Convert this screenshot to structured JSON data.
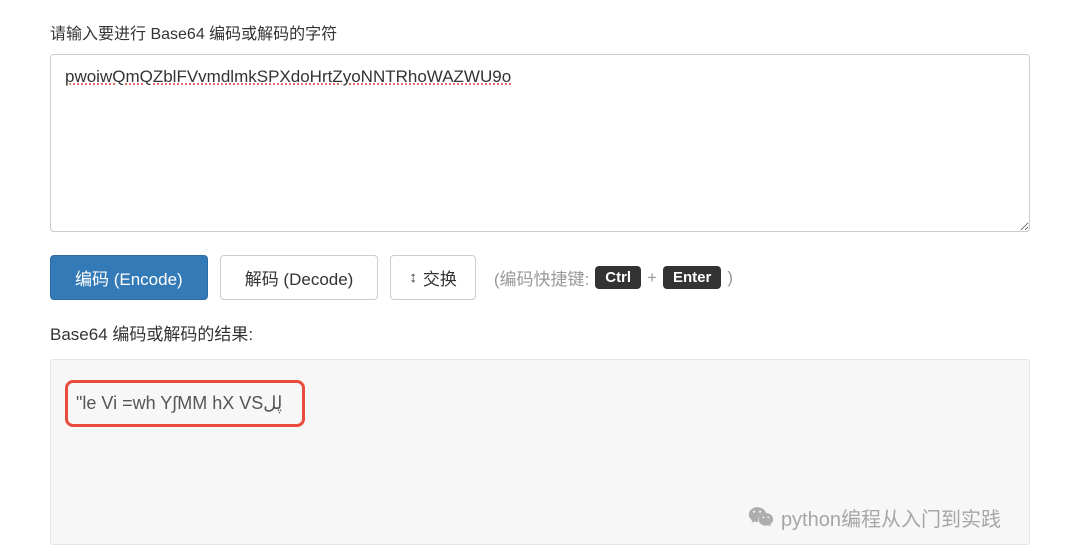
{
  "labels": {
    "input_prompt": "请输入要进行 Base64 编码或解码的字符",
    "result_prompt": "Base64 编码或解码的结果:"
  },
  "input": {
    "value": "pwoiwQmQZblFVvmdlmkSPXdoHrtZyoNNTRhoWAZWU9o"
  },
  "buttons": {
    "encode": "编码 (Encode)",
    "decode": "解码 (Decode)",
    "swap": "交换"
  },
  "shortcut": {
    "prefix": "(编码快捷键:",
    "key1": "Ctrl",
    "plus": "+",
    "key2": "Enter",
    "suffix": ")"
  },
  "output": {
    "value": "\"le Vi =wh Y∫MM hX VSڸل"
  },
  "watermark": {
    "text": "python编程从入门到实践"
  }
}
